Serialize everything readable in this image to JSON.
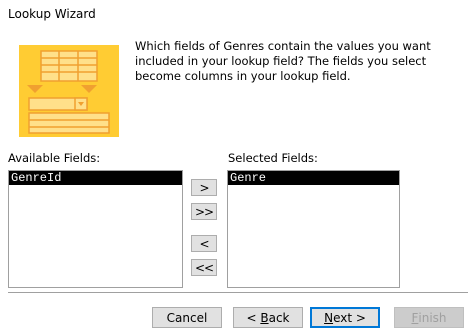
{
  "window": {
    "title": "Lookup Wizard"
  },
  "description": "Which fields of Genres contain the values you want included in your lookup field? The fields you select become columns in your lookup field.",
  "available": {
    "label": "Available Fields:",
    "items": [
      "GenreId"
    ]
  },
  "selected": {
    "label": "Selected Fields:",
    "items": [
      "Genre"
    ]
  },
  "move_buttons": {
    "add_one": ">",
    "add_all": ">>",
    "remove_one": "<",
    "remove_all": "<<"
  },
  "footer": {
    "cancel": "Cancel",
    "back_pre": "< ",
    "back_key": "B",
    "back_post": "ack",
    "next_key": "N",
    "next_post": "ext >",
    "finish_key": "F",
    "finish_post": "inish"
  },
  "colors": {
    "illustration_bg": "#ffcc33",
    "illustration_accent": "#f0a030",
    "selection": "#000000",
    "default_button_border": "#0078d7"
  }
}
